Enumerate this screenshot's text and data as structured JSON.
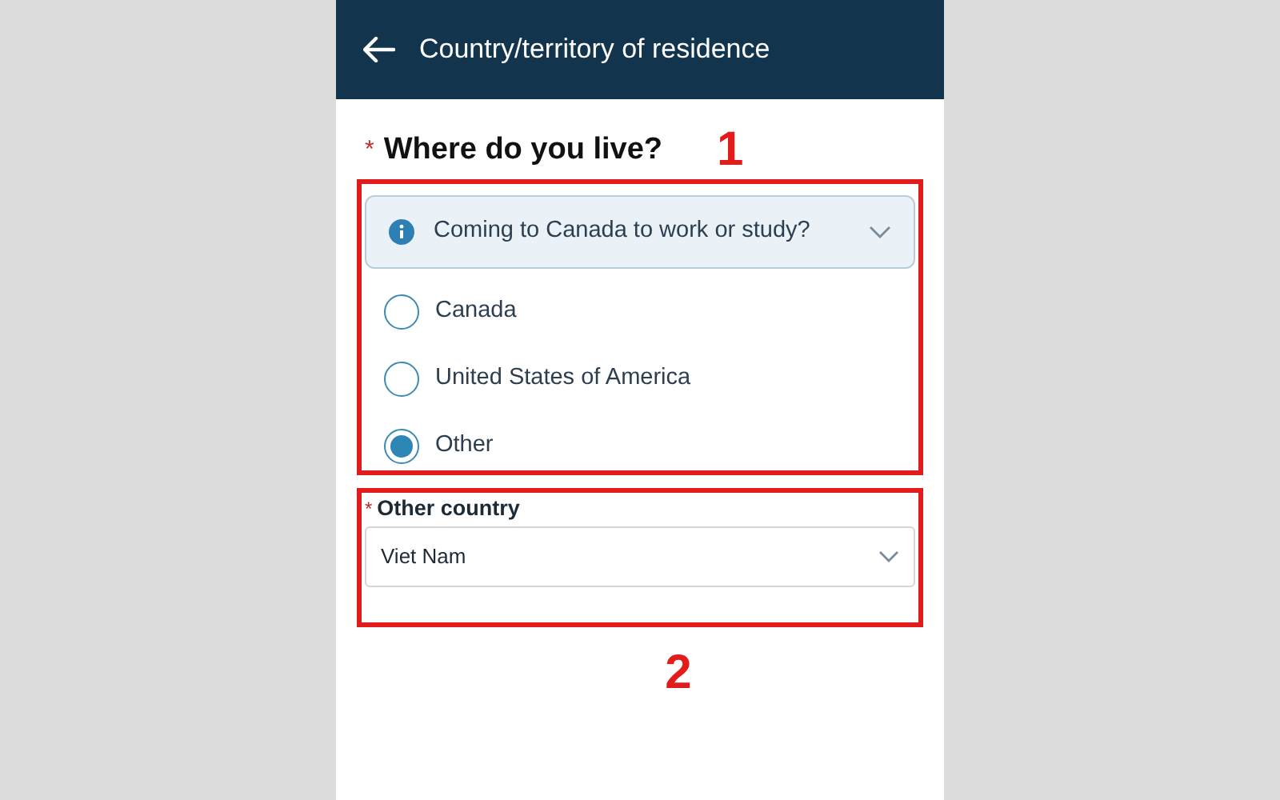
{
  "header": {
    "title": "Country/territory of residence"
  },
  "question": {
    "marker": "*",
    "label": "Where do you live?",
    "annotation": "1",
    "info": {
      "text": "Coming to Canada to work or study?",
      "expanded": false
    },
    "options": [
      {
        "label": "Canada",
        "selected": false
      },
      {
        "label": "United States of America",
        "selected": false
      },
      {
        "label": "Other",
        "selected": true
      }
    ]
  },
  "other_country": {
    "marker": "*",
    "label": "Other country",
    "value": "Viet Nam",
    "annotation": "2"
  }
}
